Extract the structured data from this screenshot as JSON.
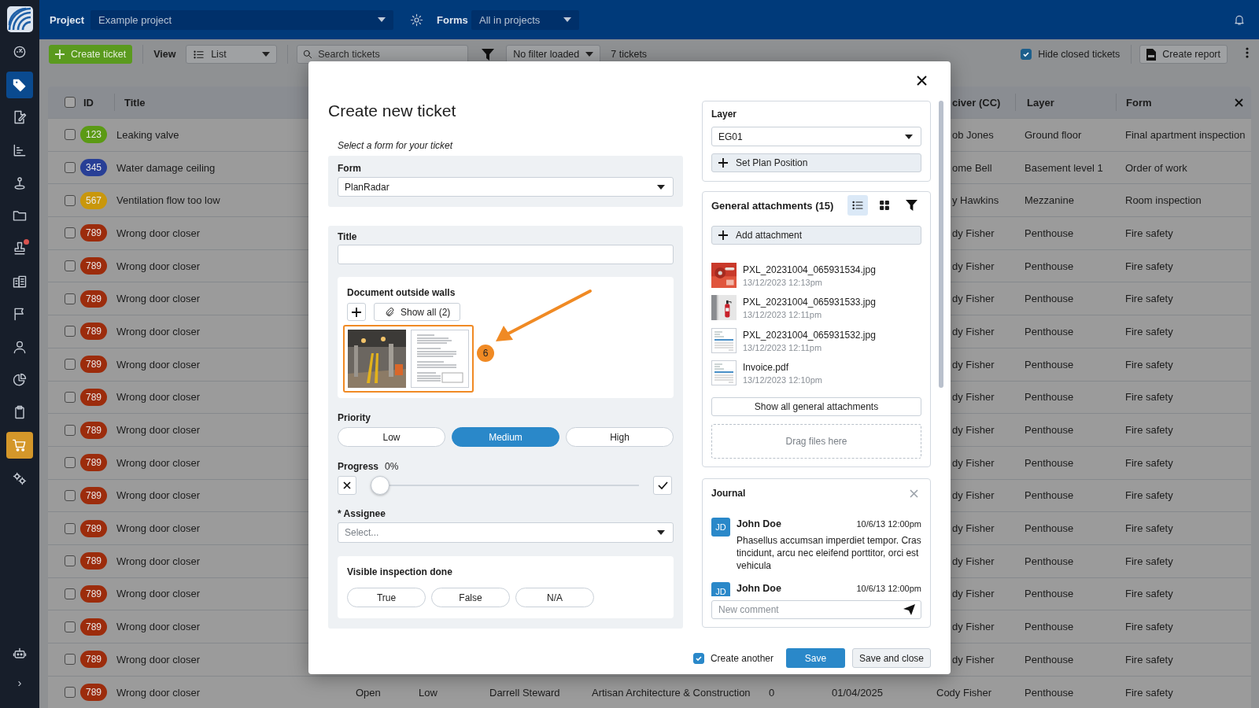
{
  "sidebar": {
    "items": [
      {
        "selected": false,
        "highlighted": false,
        "badge": false
      },
      {
        "selected": true,
        "highlighted": false,
        "badge": false
      },
      {
        "selected": false,
        "highlighted": false,
        "badge": false
      },
      {
        "selected": false,
        "highlighted": false,
        "badge": false
      },
      {
        "selected": false,
        "highlighted": false,
        "badge": false
      },
      {
        "selected": false,
        "highlighted": false,
        "badge": false
      },
      {
        "selected": false,
        "highlighted": false,
        "badge": true
      },
      {
        "selected": false,
        "highlighted": false,
        "badge": false
      },
      {
        "selected": false,
        "highlighted": false,
        "badge": false
      },
      {
        "selected": false,
        "highlighted": false,
        "badge": false
      },
      {
        "selected": false,
        "highlighted": false,
        "badge": false
      },
      {
        "selected": false,
        "highlighted": false,
        "badge": false
      },
      {
        "selected": false,
        "highlighted": true,
        "badge": false
      },
      {
        "selected": false,
        "highlighted": false,
        "badge": false
      }
    ],
    "expand": "›"
  },
  "top_bar": {
    "project_label": "Project",
    "project_value": "Example project",
    "forms_label": "Forms",
    "forms_value": "All in projects"
  },
  "toolbar": {
    "create_button": "Create ticket",
    "view_label": "View",
    "view_value": "List",
    "search_placeholder": "Search tickets",
    "filter_value": "No filter loaded",
    "count": "7 tickets",
    "hide_closed": {
      "label": "Hide closed tickets",
      "checked": true
    },
    "report_button": "Create report"
  },
  "table": {
    "select_all_checked": false,
    "columns": [
      "ID",
      "Title",
      "civer (CC)",
      "Layer",
      "Form"
    ],
    "rows": [
      {
        "checked": false,
        "id": "123",
        "color": "#5b9a14",
        "title": "Leaking valve",
        "receiver": "ob Jones",
        "layer": "Ground floor",
        "form": "Final apartment inspection"
      },
      {
        "checked": false,
        "id": "345",
        "color": "#283f96",
        "title": "Water damage ceiling",
        "receiver": "ome Bell",
        "layer": "Basement level 1",
        "form": "Order of work"
      },
      {
        "checked": false,
        "id": "567",
        "color": "#c9970c",
        "title": "Ventilation flow too low",
        "receiver": "y Hawkins",
        "layer": "Mezzanine",
        "form": "Room inspection"
      },
      {
        "checked": false,
        "id": "789",
        "color": "#9c2c0c",
        "title": "Wrong door closer",
        "receiver": "dy Fisher",
        "layer": "Penthouse",
        "form": "Fire safety"
      },
      {
        "checked": false,
        "id": "789",
        "color": "#9c2c0c",
        "title": "Wrong door closer",
        "receiver": "dy Fisher",
        "layer": "Penthouse",
        "form": "Fire safety"
      },
      {
        "checked": false,
        "id": "789",
        "color": "#9c2c0c",
        "title": "Wrong door closer",
        "receiver": "dy Fisher",
        "layer": "Penthouse",
        "form": "Fire safety"
      },
      {
        "checked": false,
        "id": "789",
        "color": "#9c2c0c",
        "title": "Wrong door closer",
        "receiver": "dy Fisher",
        "layer": "Penthouse",
        "form": "Fire safety"
      },
      {
        "checked": false,
        "id": "789",
        "color": "#9c2c0c",
        "title": "Wrong door closer",
        "receiver": "dy Fisher",
        "layer": "Penthouse",
        "form": "Fire safety"
      },
      {
        "checked": false,
        "id": "789",
        "color": "#9c2c0c",
        "title": "Wrong door closer",
        "receiver": "dy Fisher",
        "layer": "Penthouse",
        "form": "Fire safety"
      },
      {
        "checked": false,
        "id": "789",
        "color": "#9c2c0c",
        "title": "Wrong door closer",
        "receiver": "dy Fisher",
        "layer": "Penthouse",
        "form": "Fire safety"
      },
      {
        "checked": false,
        "id": "789",
        "color": "#9c2c0c",
        "title": "Wrong door closer",
        "receiver": "dy Fisher",
        "layer": "Penthouse",
        "form": "Fire safety"
      },
      {
        "checked": false,
        "id": "789",
        "color": "#9c2c0c",
        "title": "Wrong door closer",
        "receiver": "dy Fisher",
        "layer": "Penthouse",
        "form": "Fire safety"
      },
      {
        "checked": false,
        "id": "789",
        "color": "#9c2c0c",
        "title": "Wrong door closer",
        "receiver": "dy Fisher",
        "layer": "Penthouse",
        "form": "Fire safety"
      },
      {
        "checked": false,
        "id": "789",
        "color": "#9c2c0c",
        "title": "Wrong door closer",
        "receiver": "dy Fisher",
        "layer": "Penthouse",
        "form": "Fire safety"
      },
      {
        "checked": false,
        "id": "789",
        "color": "#9c2c0c",
        "title": "Wrong door closer",
        "receiver": "dy Fisher",
        "layer": "Penthouse",
        "form": "Fire safety"
      },
      {
        "checked": false,
        "id": "789",
        "color": "#9c2c0c",
        "title": "Wrong door closer",
        "receiver": "dy Fisher",
        "layer": "Penthouse",
        "form": "Fire safety"
      },
      {
        "checked": false,
        "id": "789",
        "color": "#9c2c0c",
        "title": "Wrong door closer",
        "receiver": "dy Fisher",
        "layer": "Penthouse",
        "form": "Fire safety"
      },
      {
        "checked": false,
        "id": "789",
        "color": "#9c2c0c",
        "title": "Wrong door closer",
        "status": "Open",
        "priority": "Low",
        "assignee": "Darrell Steward",
        "company": "Artisan Architecture & Construction",
        "count": "0",
        "date": "01/04/2025",
        "receiver": "Cody Fisher",
        "layer": "Penthouse",
        "form": "Fire safety"
      }
    ]
  },
  "dialog": {
    "title": "Create new ticket",
    "form_hint": "Select a form for your ticket",
    "form": {
      "label": "Form",
      "value": "PlanRadar"
    },
    "title_field": {
      "label": "Title"
    },
    "document": {
      "label": "Document outside walls",
      "show_all": "Show all (2)",
      "thumbnails": [
        {
          "kind": "picture"
        },
        {
          "kind": "document"
        }
      ],
      "marker": "6"
    },
    "priority": {
      "label": "Priority",
      "options": [
        {
          "label": "Low",
          "selected": false
        },
        {
          "label": "Medium",
          "selected": true
        },
        {
          "label": "High",
          "selected": false
        }
      ]
    },
    "progress": {
      "label": "Progress",
      "reading": "0%",
      "level": 0
    },
    "assignee": {
      "label": "* Assignee",
      "placeholder": "Select..."
    },
    "inspection": {
      "label": "Visible inspection done",
      "options": [
        {
          "label": "True",
          "selected": false
        },
        {
          "label": "False",
          "selected": false
        },
        {
          "label": "N/A",
          "selected": false
        }
      ]
    },
    "layer": {
      "label": "Layer",
      "value": "EG01",
      "button": "Set Plan Position"
    },
    "attachments": {
      "title": "General attachments (15)",
      "views": [
        {
          "selected": true
        },
        {
          "selected": false
        }
      ],
      "add_button": "Add attachment",
      "files": [
        {
          "name": "PXL_20231004_065931534.jpg",
          "date": "13/12/2023 12:13pm",
          "kind": "picture"
        },
        {
          "name": "PXL_20231004_065931533.jpg",
          "date": "13/12/2023 12:11pm",
          "kind": "picture"
        },
        {
          "name": "PXL_20231004_065931532.jpg",
          "date": "13/12/2023 12:11pm",
          "kind": "document"
        },
        {
          "name": "Invoice.pdf",
          "date": "13/12/2023 12:10pm",
          "kind": "document"
        }
      ],
      "show_all": "Show all general attachments",
      "drop_hint": "Drag files here"
    },
    "journal": {
      "title": "Journal",
      "entries": [
        {
          "initials": "JD",
          "author": "John Doe",
          "date": "10/6/13 12:00pm",
          "text": "Phasellus accumsan imperdiet tempor. Cras tincidunt, arcu nec eleifend porttitor, orci est vehicula"
        },
        {
          "initials": "JD",
          "author": "John Doe",
          "date": "10/6/13 12:00pm"
        }
      ],
      "placeholder": "New comment"
    },
    "footer": {
      "create_another": {
        "label": "Create another",
        "checked": true
      },
      "save": "Save",
      "save_close": "Save and close"
    }
  }
}
